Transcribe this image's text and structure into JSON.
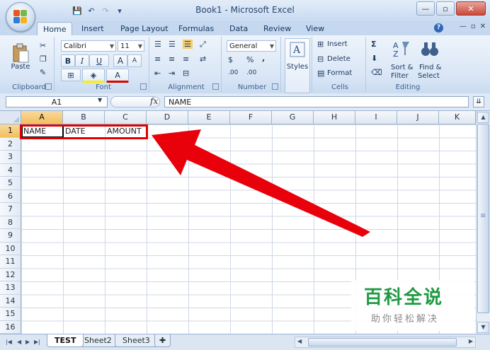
{
  "window": {
    "title": "Book1 - Microsoft Excel",
    "controls": {
      "minimize": "—",
      "restore": "▫",
      "close": "✕"
    }
  },
  "qat": {
    "save": "💾",
    "undo": "↶",
    "redo": "↷",
    "customize": "▾"
  },
  "tabs": [
    "Home",
    "Insert",
    "Page Layout",
    "Formulas",
    "Data",
    "Review",
    "View"
  ],
  "active_tab": "Home",
  "ribbon": {
    "clipboard": {
      "label": "Clipboard",
      "paste": "Paste"
    },
    "font": {
      "label": "Font",
      "name": "Calibri",
      "size": "11",
      "bold": "B",
      "italic": "I",
      "underline": "U",
      "grow": "A",
      "shrink": "A"
    },
    "alignment": {
      "label": "Alignment"
    },
    "number": {
      "label": "Number",
      "format": "General",
      "currency": "$",
      "percent": "%",
      "comma": ",",
      "inc_dec": ".00"
    },
    "styles": {
      "label": "Styles"
    },
    "cells": {
      "label": "Cells",
      "insert": "Insert",
      "delete": "Delete",
      "format": "Format"
    },
    "editing": {
      "label": "Editing",
      "sort": "Sort &",
      "sort2": "Filter",
      "find": "Find &",
      "find2": "Select",
      "sum": "Σ"
    }
  },
  "formula_bar": {
    "name_box": "A1",
    "fx": "fx",
    "content": "NAME"
  },
  "sheet": {
    "columns": [
      "A",
      "B",
      "C",
      "D",
      "E",
      "F",
      "G",
      "H",
      "I",
      "J",
      "K"
    ],
    "rows": [
      "1",
      "2",
      "3",
      "4",
      "5",
      "6",
      "7",
      "8",
      "9",
      "10",
      "11",
      "12",
      "13",
      "14",
      "15",
      "16"
    ],
    "cells": {
      "A1": "NAME",
      "B1": "DATE",
      "C1": "AMOUNT"
    },
    "active_cell": "A1"
  },
  "sheet_tabs": [
    "TEST",
    "Sheet2",
    "Sheet3"
  ],
  "active_sheet": "TEST",
  "watermark": {
    "title": "百科全说",
    "subtitle": "助你轻松解决"
  },
  "colors": {
    "highlight": "#e30000",
    "arrow": "#e8000b",
    "watermark_green": "#1f9a42"
  }
}
